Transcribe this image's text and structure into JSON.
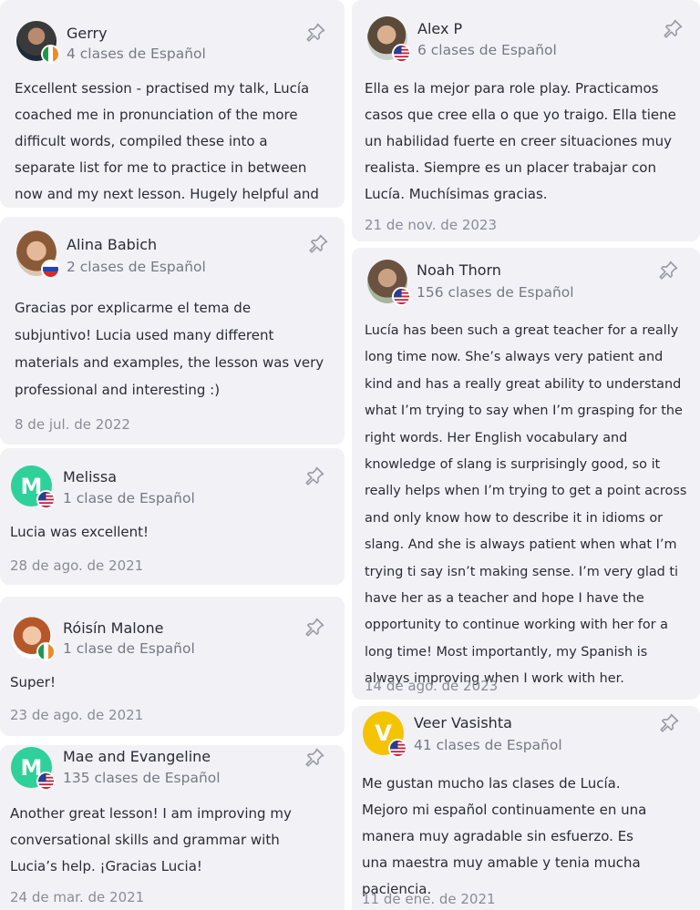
{
  "colors": {
    "card_bg": "#f2f2f6",
    "initial_green": "#2ed19a",
    "initial_yellow": "#f5c400",
    "text_primary": "#2b2b33",
    "text_secondary": "#787885"
  },
  "reviews": [
    {
      "name": "Gerry",
      "lessons": "4 clases de Español",
      "flag": "ireland",
      "text": "Excellent session - practised my talk, Lucía coached me in pronunciation of the more difficult words, compiled these into a separate list for me to practice in between now and my next lesson. Hugely helpful and enjoyable lesson.",
      "date": ""
    },
    {
      "name": "Alina Babich",
      "lessons": "2 clases de Español",
      "flag": "russia",
      "text": "Gracias por explicarme el tema de subjuntivo! Lucia used many different materials and examples, the lesson was very professional and interesting :)",
      "date": "8 de jul. de 2022"
    },
    {
      "name": "Melissa",
      "initial": "M",
      "lessons": "1 clase de Español",
      "flag": "usa",
      "text": "Lucia was excellent!",
      "date": "28 de ago. de 2021"
    },
    {
      "name": "Róisín Malone",
      "lessons": "1 clase de Español",
      "flag": "ireland",
      "text": "Super!",
      "date": "23 de ago. de 2021"
    },
    {
      "name": "Mae and Evangeline",
      "initial": "M",
      "lessons": "135 clases de Español",
      "flag": "usa",
      "text": "Another great lesson! I am improving my conversational skills and grammar with Lucia’s help. ¡Gracias Lucia!",
      "date": "24 de mar. de 2021"
    },
    {
      "name": "Alex P",
      "lessons": "6 clases de Español",
      "flag": "usa",
      "text": "Ella es la mejor para role play. Practicamos casos que cree ella o que yo traigo. Ella tiene un habilidad fuerte en creer situaciones muy realista. Siempre es un placer trabajar con Lucía. Muchísimas gracias.",
      "date": "21 de nov. de 2023"
    },
    {
      "name": "Noah Thorn",
      "lessons": "156 clases de Español",
      "flag": "usa",
      "text": "Lucía has been such a great teacher for a really long time now. She’s always very patient and kind and has a really great ability to understand what I’m trying to say when I’m grasping for the right words. Her English vocabulary and knowledge of slang is surprisingly good, so it really helps when I’m trying to get a point across and only know how to describe it in idioms or slang. And she is always patient when what I’m trying ti say isn’t making sense. I’m very glad ti have her as a teacher and hope I have the opportunity to continue working with her for a long time! Most importantly, my Spanish is always improving when I work with her.",
      "date": "14 de ago. de 2023"
    },
    {
      "name": "Veer Vasishta",
      "initial": "V",
      "lessons": "41 clases de Español",
      "flag": "usa",
      "text": "Me gustan mucho las clases de Lucía. Mejoro mi español continuamente en una manera muy agradable sin esfuerzo. Es una maestra muy amable y tenia mucha paciencia.",
      "date": "11 de ene. de 2021"
    }
  ]
}
